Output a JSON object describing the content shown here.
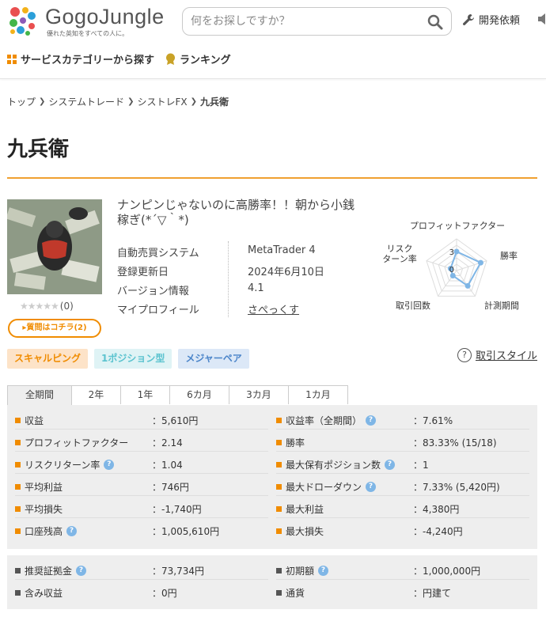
{
  "header": {
    "logo_text": "GogoJungle",
    "tagline": "優れた英知をすべての人に。",
    "search_placeholder": "何をお探しですか？",
    "dev_request": "開発依頼",
    "nav": [
      "サービスカテゴリーから探す",
      "ランキング"
    ]
  },
  "breadcrumb": [
    "トップ",
    "システムトレード",
    "シストレFX",
    "九兵衛"
  ],
  "title": "九兵衛",
  "product": {
    "subtitle": "ナンピンじゃないのに高勝率！！朝から小銭稼ぎ(*´▽｀*)",
    "rating_count": "(0)",
    "ask_button": "質問はコチラ(2)",
    "info": [
      {
        "label": "自動売買システム",
        "value": "MetaTrader 4"
      },
      {
        "label": "登録更新日",
        "value": "2024年6月10日"
      },
      {
        "label": "バージョン情報",
        "value": "4.1"
      },
      {
        "label": "マイプロフィール",
        "value": "さぺっくす"
      }
    ]
  },
  "radar": {
    "labels": [
      "プロフィットファクター",
      "勝率",
      "計測期間",
      "取引回数",
      "リスクリターン率"
    ],
    "label_lines": [
      [
        "プロフィットファクター"
      ],
      [
        "勝率"
      ],
      [
        "計測期間"
      ],
      [
        "取引回数"
      ],
      [
        "リスク",
        "ターン率"
      ]
    ],
    "ticks": [
      "3",
      "0"
    ],
    "values": [
      3,
      4,
      3,
      1,
      1
    ],
    "max": 5,
    "color": "#7fb6e6"
  },
  "tags": [
    "スキャルピング",
    "1ポジション型",
    "メジャーペア"
  ],
  "trade_style_link": "取引スタイル",
  "tabs": [
    "全期間",
    "2年",
    "1年",
    "6カ月",
    "3カ月",
    "1カ月"
  ],
  "stats_left": [
    {
      "label": "収益",
      "value": "：5,610円",
      "help": false
    },
    {
      "label": "プロフィットファクター",
      "value": "：2.14",
      "help": false
    },
    {
      "label": "リスクリターン率",
      "value": "：1.04",
      "help": true
    },
    {
      "label": "平均利益",
      "value": "：746円",
      "help": false
    },
    {
      "label": "平均損失",
      "value": "：-1,740円",
      "help": false
    },
    {
      "label": "口座残高",
      "value": "：1,005,610円",
      "help": true
    }
  ],
  "stats_right": [
    {
      "label": "収益率（全期間）",
      "value": "：7.61%",
      "help": true
    },
    {
      "label": "勝率",
      "value": "：83.33% (15/18)",
      "help": false
    },
    {
      "label": "最大保有ポジション数",
      "value": "：1",
      "help": true
    },
    {
      "label": "最大ドローダウン",
      "value": "：7.33% (5,420円)",
      "help": true
    },
    {
      "label": "最大利益",
      "value": "：4,380円",
      "help": false
    },
    {
      "label": "最大損失",
      "value": "：-4,240円",
      "help": false
    }
  ],
  "stats2_left": [
    {
      "label": "推奨証拠金",
      "value": "：73,734円",
      "help": true
    },
    {
      "label": "含み収益",
      "value": "：0円",
      "help": false
    }
  ],
  "stats2_right": [
    {
      "label": "初期額",
      "value": "：1,000,000円",
      "help": true
    },
    {
      "label": "通貨",
      "value": "：円建て",
      "help": false
    }
  ],
  "colors": {
    "accent": "#f08c00",
    "help": "#7fb6e6"
  }
}
